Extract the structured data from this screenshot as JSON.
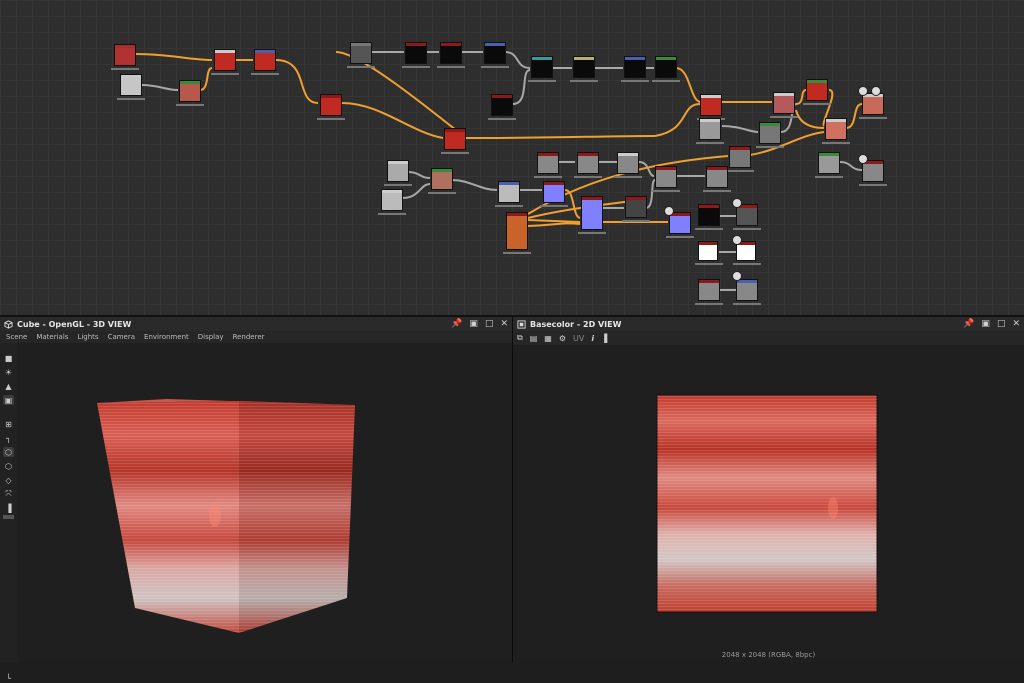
{
  "graph": {
    "nodes": [
      {
        "id": "n1",
        "hdr": "#a23030",
        "body": "#b03232"
      },
      {
        "id": "n2",
        "hdr": "#c9c9c9",
        "body": "#c6c6c6"
      },
      {
        "id": "n3",
        "hdr": "#3a8a3a",
        "body": "#b55a4a"
      },
      {
        "id": "n4",
        "hdr": "#cccccc",
        "body": "#c02a20"
      },
      {
        "id": "n5",
        "hdr": "#4a5fb0",
        "body": "#c02a20"
      },
      {
        "id": "n6",
        "hdr": "#777777",
        "body": "#555555"
      },
      {
        "id": "n7",
        "hdr": "#8b1a1a",
        "body": "#0a0a0a"
      },
      {
        "id": "n8",
        "hdr": "#8b1a1a",
        "body": "#0a0a0a"
      },
      {
        "id": "n9",
        "hdr": "#4a5fb0",
        "body": "#0a0a0a"
      },
      {
        "id": "n10",
        "hdr": "#8b1a1a",
        "body": "#c02a20"
      },
      {
        "id": "n11",
        "hdr": "#8b1a1a",
        "body": "#c02a20"
      },
      {
        "id": "n12",
        "hdr": "#3a9a9a",
        "body": "#0a0a0a"
      },
      {
        "id": "n13",
        "hdr": "#b8b070",
        "body": "#0a0a0a"
      },
      {
        "id": "n14",
        "hdr": "#4a5fb0",
        "body": "#0a0a0a"
      },
      {
        "id": "n15",
        "hdr": "#3a8a3a",
        "body": "#0a0a0a"
      },
      {
        "id": "n16",
        "hdr": "#8b1a1a",
        "body": "#0a0a0a"
      },
      {
        "id": "n17",
        "hdr": "#cccccc",
        "body": "#c02a20"
      },
      {
        "id": "n18",
        "hdr": "#cccccc",
        "body": "#b55a5a"
      },
      {
        "id": "n19",
        "hdr": "#3a8a3a",
        "body": "#c02a20"
      },
      {
        "id": "n20",
        "hdr": "#cccccc",
        "body": "#999999"
      },
      {
        "id": "n21",
        "hdr": "#3a8a3a",
        "body": "#777777"
      },
      {
        "id": "n22",
        "hdr": "#cccccc",
        "body": "#c86a5a"
      },
      {
        "id": "n23",
        "hdr": "#cccccc",
        "body": "#d07060"
      },
      {
        "id": "n24",
        "hdr": "#8b1a1a",
        "body": "#777777"
      },
      {
        "id": "n25",
        "hdr": "#3a8a3a",
        "body": "#999999"
      },
      {
        "id": "n26",
        "hdr": "#8b1a1a",
        "body": "#888888"
      },
      {
        "id": "n27",
        "hdr": "#cccccc",
        "body": "#aaaaaa"
      },
      {
        "id": "n28",
        "hdr": "#3a8a3a",
        "body": "#b07060"
      },
      {
        "id": "n29",
        "hdr": "#cccccc",
        "body": "#bbbbbb"
      },
      {
        "id": "n30",
        "hdr": "#4a5fb0",
        "body": "#bbbbbb"
      },
      {
        "id": "n31",
        "hdr": "#8b1a1a",
        "body": "#888888"
      },
      {
        "id": "n32",
        "hdr": "#8b1a1a",
        "body": "#888888"
      },
      {
        "id": "n33",
        "hdr": "#cccccc",
        "body": "#888888"
      },
      {
        "id": "n34",
        "hdr": "#8b1a1a",
        "body": "#888888"
      },
      {
        "id": "n35",
        "hdr": "#8b1a1a",
        "body": "#888888"
      },
      {
        "id": "n36",
        "hdr": "#8b1a1a",
        "body": "#8080ff"
      },
      {
        "id": "n37",
        "hdr": "#8b1a1a",
        "body": "#c8642a"
      },
      {
        "id": "n38",
        "hdr": "#8b1a1a",
        "body": "#8080ff"
      },
      {
        "id": "n39",
        "hdr": "#8b1a1a",
        "body": "#444444"
      },
      {
        "id": "n40",
        "hdr": "#8b1a1a",
        "body": "#8080ff"
      },
      {
        "id": "n41",
        "hdr": "#8b1a1a",
        "body": "#0a0a0a"
      },
      {
        "id": "n42",
        "hdr": "#8b1a1a",
        "body": "#555555"
      },
      {
        "id": "n43",
        "hdr": "#8b1a1a",
        "body": "#0a0a0a"
      },
      {
        "id": "n44",
        "hdr": "#8b1a1a",
        "body": "#0a0a0a"
      },
      {
        "id": "n45",
        "hdr": "#8b1a1a",
        "body": "#ffffff"
      },
      {
        "id": "n46",
        "hdr": "#8b1a1a",
        "body": "#ffffff"
      },
      {
        "id": "n47",
        "hdr": "#8b1a1a",
        "body": "#888888"
      },
      {
        "id": "n48",
        "hdr": "#4a5fb0",
        "body": "#888888"
      }
    ],
    "wire_colors": {
      "orange": "#f0a030",
      "gray": "#a8a8a8"
    }
  },
  "view3d": {
    "icon": "cube-icon",
    "title": "Cube - OpenGL - 3D VIEW",
    "menu": [
      "Scene",
      "Materials",
      "Lights",
      "Camera",
      "Environment",
      "Display",
      "Renderer"
    ],
    "controls": [
      "pin-icon",
      "float-icon",
      "maximize-icon",
      "close-icon"
    ]
  },
  "view2d": {
    "icon": "image-icon",
    "title": "Basecolor - 2D VIEW",
    "tools": [
      "copy-icon",
      "save-icon",
      "channels-icon",
      "settings-icon",
      "uv-label",
      "info-icon",
      "histogram-icon"
    ],
    "uv_label": "UV",
    "status": "2048 x 2048 (RGBA, 8bpc)",
    "controls": [
      "pin-icon",
      "float-icon",
      "maximize-icon",
      "close-icon"
    ]
  },
  "colors": {
    "wood_dark": "#b83a2e",
    "wood_light": "#d8b8b0",
    "bg": "#1e1e1e"
  }
}
